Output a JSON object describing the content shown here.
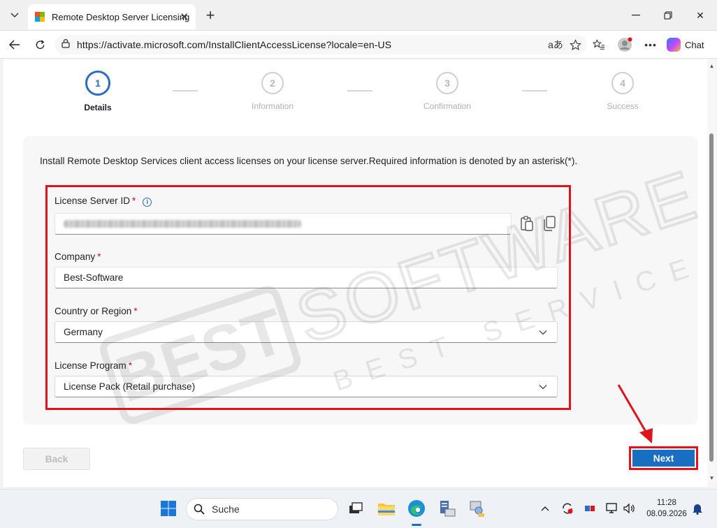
{
  "browser": {
    "tab_title": "Remote Desktop Server Licensing",
    "url": "https://activate.microsoft.com/InstallClientAccessLicense?locale=en-US",
    "chat_label": "Chat"
  },
  "stepper": [
    {
      "number": "1",
      "label": "Details",
      "state": "active"
    },
    {
      "number": "2",
      "label": "Information",
      "state": "inactive"
    },
    {
      "number": "3",
      "label": "Confirmation",
      "state": "inactive"
    },
    {
      "number": "4",
      "label": "Success",
      "state": "inactive"
    }
  ],
  "form": {
    "intro": "Install Remote Desktop Services client access licenses on your license server.Required information is denoted by an asterisk(*).",
    "required_marker": "*",
    "license_server_id": {
      "label": "License Server ID",
      "value": ""
    },
    "company": {
      "label": "Company",
      "value": "Best-Software"
    },
    "country": {
      "label": "Country or Region",
      "value": "Germany"
    },
    "program": {
      "label": "License Program",
      "value": "License Pack (Retail purchase)"
    }
  },
  "buttons": {
    "back": "Back",
    "next": "Next"
  },
  "watermark": {
    "line1": "BEST SOFTWARE",
    "line2": "BEST SERVICE"
  },
  "taskbar": {
    "search_placeholder": "Suche",
    "time": "11:28",
    "date": "08.09.2026"
  },
  "colors": {
    "accent": "#1a6ec1",
    "highlight": "#e0131c",
    "required": "#c50f1f"
  }
}
